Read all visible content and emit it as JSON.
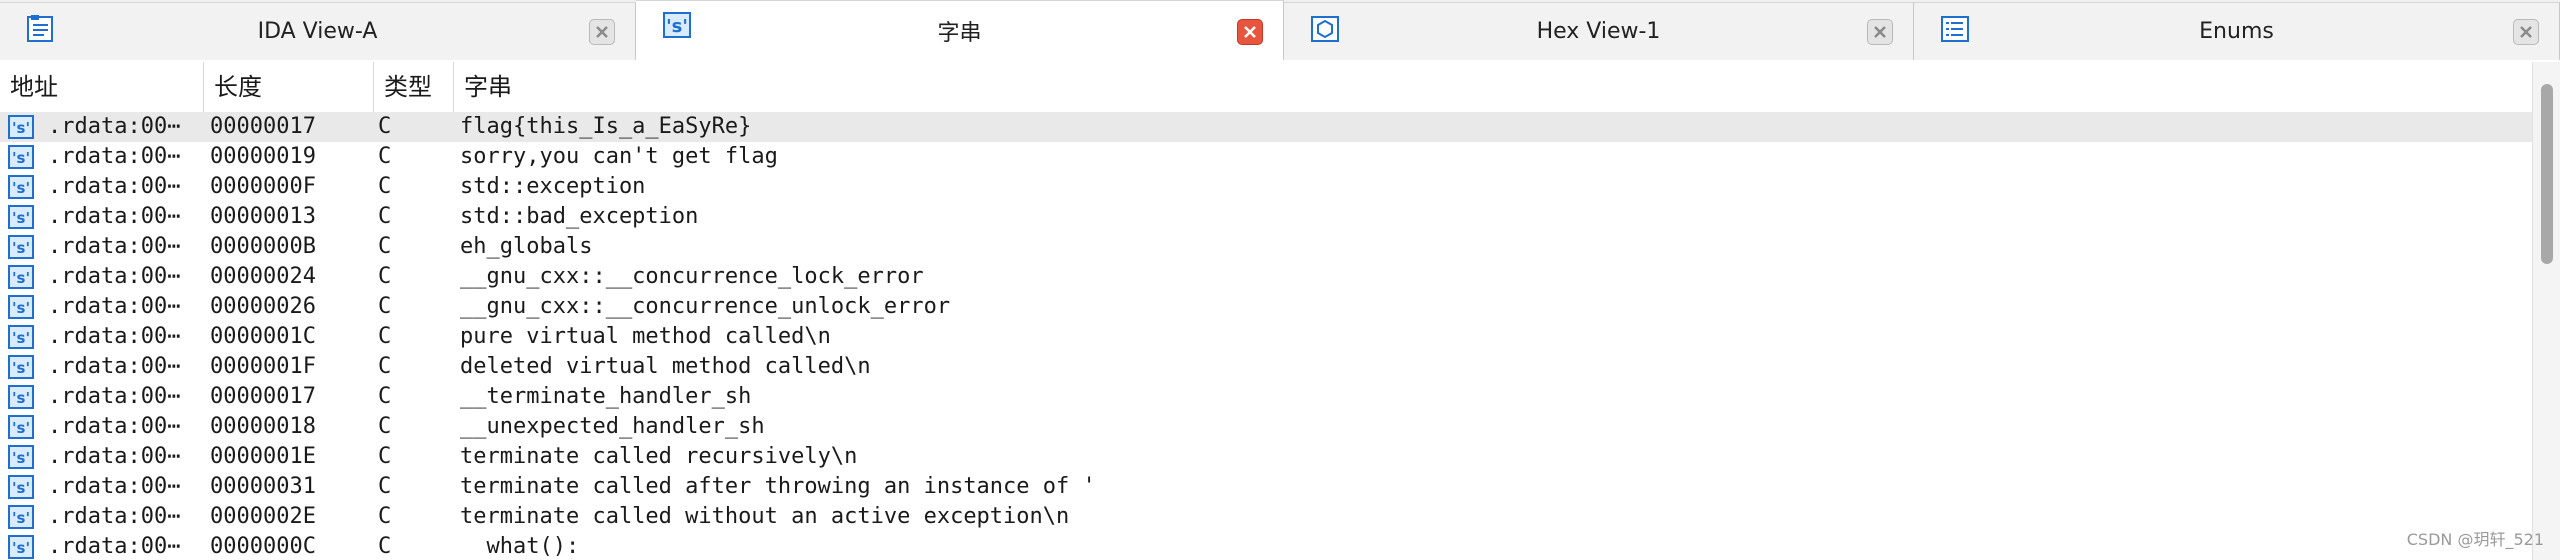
{
  "tabs": [
    {
      "label": "IDA View-A",
      "icon": "ida-view-icon",
      "active": false
    },
    {
      "label": "字串",
      "icon": "strings-icon",
      "active": true
    },
    {
      "label": "Hex View-1",
      "icon": "hex-view-icon",
      "active": false
    },
    {
      "label": "Enums",
      "icon": "enums-icon",
      "active": false
    }
  ],
  "columns": {
    "address": "地址",
    "length": "长度",
    "type": "类型",
    "string": "字串"
  },
  "rows": [
    {
      "address": ".rdata:00⋯",
      "length": "00000017",
      "type": "C",
      "string": "flag{this_Is_a_EaSyRe}"
    },
    {
      "address": ".rdata:00⋯",
      "length": "00000019",
      "type": "C",
      "string": "sorry,you can't get flag"
    },
    {
      "address": ".rdata:00⋯",
      "length": "0000000F",
      "type": "C",
      "string": "std::exception"
    },
    {
      "address": ".rdata:00⋯",
      "length": "00000013",
      "type": "C",
      "string": "std::bad_exception"
    },
    {
      "address": ".rdata:00⋯",
      "length": "0000000B",
      "type": "C",
      "string": "eh_globals"
    },
    {
      "address": ".rdata:00⋯",
      "length": "00000024",
      "type": "C",
      "string": "__gnu_cxx::__concurrence_lock_error"
    },
    {
      "address": ".rdata:00⋯",
      "length": "00000026",
      "type": "C",
      "string": "__gnu_cxx::__concurrence_unlock_error"
    },
    {
      "address": ".rdata:00⋯",
      "length": "0000001C",
      "type": "C",
      "string": "pure virtual method called\\n"
    },
    {
      "address": ".rdata:00⋯",
      "length": "0000001F",
      "type": "C",
      "string": "deleted virtual method called\\n"
    },
    {
      "address": ".rdata:00⋯",
      "length": "00000017",
      "type": "C",
      "string": "__terminate_handler_sh"
    },
    {
      "address": ".rdata:00⋯",
      "length": "00000018",
      "type": "C",
      "string": "__unexpected_handler_sh"
    },
    {
      "address": ".rdata:00⋯",
      "length": "0000001E",
      "type": "C",
      "string": "terminate called recursively\\n"
    },
    {
      "address": ".rdata:00⋯",
      "length": "00000031",
      "type": "C",
      "string": "terminate called after throwing an instance of '"
    },
    {
      "address": ".rdata:00⋯",
      "length": "0000002E",
      "type": "C",
      "string": "terminate called without an active exception\\n"
    },
    {
      "address": ".rdata:00⋯",
      "length": "0000000C",
      "type": "C",
      "string": "  what():"
    }
  ],
  "watermark": "CSDN @玥轩_521",
  "colors": {
    "close_active": "#e8553f",
    "selected_row": "#e9e9e9",
    "icon_blue": "#1e6fd0"
  }
}
